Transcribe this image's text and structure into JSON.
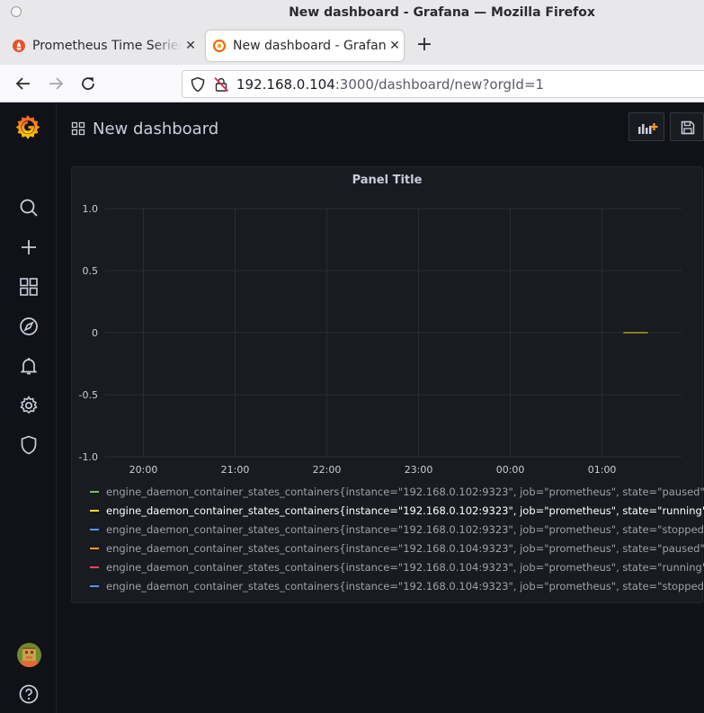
{
  "browser": {
    "window_title": "New dashboard - Grafana — Mozilla Firefox",
    "tabs": [
      {
        "label": "Prometheus Time Series Collection",
        "active": false
      },
      {
        "label": "New dashboard - Grafana",
        "active": true
      }
    ],
    "url_host": "192.168.0.104",
    "url_rest": ":3000/dashboard/new?orgId=1",
    "close_glyph": "✕",
    "new_tab_glyph": "+"
  },
  "sidebar": {
    "items": [
      "grafana-logo-icon",
      "search-icon",
      "plus-icon",
      "dashboards-icon",
      "compass-icon",
      "bell-icon",
      "gear-icon",
      "shield-icon",
      "avatar",
      "help-icon"
    ]
  },
  "dashboard": {
    "title": "New dashboard",
    "add_panel_icon": "add-panel-icon",
    "save_icon": "save-icon"
  },
  "panel": {
    "title": "Panel Title"
  },
  "chart_data": {
    "type": "line",
    "title": "Panel Title",
    "xlabel": "",
    "ylabel": "",
    "ylim": [
      -1.0,
      1.0
    ],
    "y_ticks": [
      "1.0",
      "0.5",
      "0",
      "-0.5",
      "-1.0"
    ],
    "y_tick_values": [
      1.0,
      0.5,
      0,
      -0.5,
      -1.0
    ],
    "x_ticks": [
      "20:00",
      "21:00",
      "22:00",
      "23:00",
      "00:00",
      "01:00"
    ],
    "x_range_hours": [
      "19:35",
      "01:52"
    ],
    "grid": true,
    "legend_placement": "bottom",
    "series": [
      {
        "name": "engine_daemon_container_states_containers{instance=\"192.168.0.102:9323\", job=\"prometheus\", state=\"paused\"}",
        "color": "#73bf69",
        "values": []
      },
      {
        "name": "engine_daemon_container_states_containers{instance=\"192.168.0.102:9323\", job=\"prometheus\", state=\"running\"}",
        "color": "#fade2a",
        "active": true,
        "x": [
          "01:14",
          "01:30"
        ],
        "values": [
          0,
          0
        ]
      },
      {
        "name": "engine_daemon_container_states_containers{instance=\"192.168.0.102:9323\", job=\"prometheus\", state=\"stopped\"}",
        "color": "#5794f2",
        "values": []
      },
      {
        "name": "engine_daemon_container_states_containers{instance=\"192.168.0.104:9323\", job=\"prometheus\", state=\"paused\"}",
        "color": "#ff9830",
        "values": []
      },
      {
        "name": "engine_daemon_container_states_containers{instance=\"192.168.0.104:9323\", job=\"prometheus\", state=\"running\"}",
        "color": "#f2495c",
        "values": []
      },
      {
        "name": "engine_daemon_container_states_containers{instance=\"192.168.0.104:9323\", job=\"prometheus\", state=\"stopped\"}",
        "color": "#5794f2",
        "values": []
      }
    ]
  }
}
